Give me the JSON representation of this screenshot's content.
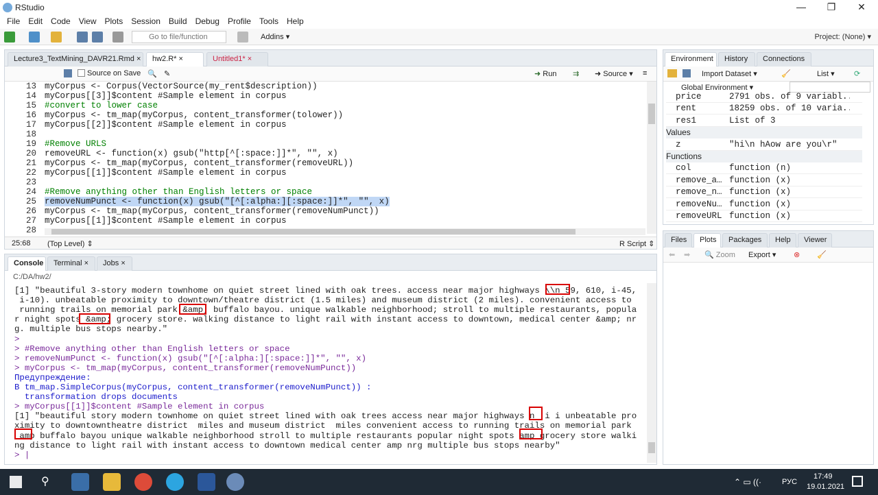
{
  "window": {
    "title": "RStudio",
    "min": "—",
    "max": "❐",
    "close": "✕"
  },
  "menu": [
    "File",
    "Edit",
    "Code",
    "View",
    "Plots",
    "Session",
    "Build",
    "Debug",
    "Profile",
    "Tools",
    "Help"
  ],
  "toolbar": {
    "goto_placeholder": "Go to file/function",
    "addins": "Addins ▾",
    "project": "Project: (None) ▾"
  },
  "editor": {
    "tabs": [
      "Lecture3_TextMining_DAVR21.Rmd",
      "hw2.R*",
      "Untitled1*"
    ],
    "source_on_save": "Source on Save",
    "run": "Run",
    "source": "Source ▾",
    "lines": [
      {
        "n": "13",
        "t": "myCorpus <- Corpus(VectorSource(my_rent$description))"
      },
      {
        "n": "14",
        "t": "myCorpus[[3]]$content #Sample element in corpus"
      },
      {
        "n": "15",
        "t": "#convert to lower case"
      },
      {
        "n": "16",
        "t": "myCorpus <- tm_map(myCorpus, content_transformer(tolower))"
      },
      {
        "n": "17",
        "t": "myCorpus[[2]]$content #Sample element in corpus"
      },
      {
        "n": "18",
        "t": ""
      },
      {
        "n": "19",
        "t": "#Remove URLS"
      },
      {
        "n": "20",
        "t": "removeURL <- function(x) gsub(\"http[^[:space:]]*\", \"\", x)"
      },
      {
        "n": "21",
        "t": "myCorpus <- tm_map(myCorpus, content_transformer(removeURL))"
      },
      {
        "n": "22",
        "t": "myCorpus[[1]]$content #Sample element in corpus"
      },
      {
        "n": "23",
        "t": ""
      },
      {
        "n": "24",
        "t": "#Remove anything other than English letters or space"
      },
      {
        "n": "25",
        "t": "removeNumPunct <- function(x) gsub(\"[^[:alpha:][:space:]]*\", \"\", x)"
      },
      {
        "n": "26",
        "t": "myCorpus <- tm_map(myCorpus, content_transformer(removeNumPunct))"
      },
      {
        "n": "27",
        "t": "myCorpus[[1]]$content #Sample element in corpus"
      },
      {
        "n": "28",
        "t": ""
      }
    ],
    "status_pos": "25:68",
    "status_scope": "(Top Level) ⇕",
    "status_type": "R Script ⇕"
  },
  "console": {
    "tabs": [
      "Console",
      "Terminal",
      "Jobs"
    ],
    "path": "C:/DA/hw2/",
    "lines": [
      {
        "c": "out",
        "t": "[1] \"beautiful 3-story modern townhome on quiet street lined with oak trees. access near major highways \\\\n 59, 610, i-45,"
      },
      {
        "c": "out",
        "t": " i-10). unbeatable proximity to downtown/theatre district (1.5 miles) and museum district (2 miles). convenient access to"
      },
      {
        "c": "out",
        "t": " running trails on memorial park &amp; buffalo bayou. unique walkable neighborhood; stroll to multiple restaurants, popula"
      },
      {
        "c": "out",
        "t": "r night spots &amp; grocery store. walking distance to light rail with instant access to downtown, medical center &amp; nr"
      },
      {
        "c": "out",
        "t": "g. multiple bus stops nearby.\""
      },
      {
        "c": "echo",
        "t": ">"
      },
      {
        "c": "echo",
        "t": "> #Remove anything other than English letters or space"
      },
      {
        "c": "echo",
        "t": "> removeNumPunct <- function(x) gsub(\"[^[:alpha:][:space:]]*\", \"\", x)"
      },
      {
        "c": "echo",
        "t": "> myCorpus <- tm_map(myCorpus, content_transformer(removeNumPunct))"
      },
      {
        "c": "blue",
        "t": "Предупреждение:"
      },
      {
        "c": "blue",
        "t": "В tm_map.SimpleCorpus(myCorpus, content_transformer(removeNumPunct)) :"
      },
      {
        "c": "blue",
        "t": "  transformation drops documents"
      },
      {
        "c": "echo",
        "t": "> myCorpus[[1]]$content #Sample element in corpus"
      },
      {
        "c": "out",
        "t": "[1] \"beautiful story modern townhome on quiet street lined with oak trees access near major highways n  i i unbeatable pro"
      },
      {
        "c": "out",
        "t": "ximity to downtowntheatre district  miles and museum district  miles convenient access to running trails on memorial park"
      },
      {
        "c": "out",
        "t": " amp buffalo bayou unique walkable neighborhood stroll to multiple restaurants popular night spots amp grocery store walki"
      },
      {
        "c": "out",
        "t": "ng distance to light rail with instant access to downtown medical center amp nrg multiple bus stops nearby\""
      },
      {
        "c": "echo",
        "t": "> |"
      }
    ]
  },
  "environment": {
    "tabs": [
      "Environment",
      "History",
      "Connections"
    ],
    "import": "Import Dataset ▾",
    "list": "List ▾",
    "global": "Global Environment ▾",
    "rows": [
      {
        "k": "r",
        "name": "price",
        "value": "2791 obs. of 9 variabl..."
      },
      {
        "k": "r",
        "name": "rent",
        "value": "18259 obs. of 10 varia..."
      },
      {
        "k": "r",
        "name": "res1",
        "value": "List of 3"
      },
      {
        "k": "h",
        "name": "Values"
      },
      {
        "k": "r",
        "name": "z",
        "value": "\"hi\\n hAow are you\\r\""
      },
      {
        "k": "h",
        "name": "Functions"
      },
      {
        "k": "r",
        "name": "col",
        "value": "function (n)"
      },
      {
        "k": "r",
        "name": "remove_a…",
        "value": "function (x)"
      },
      {
        "k": "r",
        "name": "remove_n…",
        "value": "function (x)"
      },
      {
        "k": "r",
        "name": "removeNu…",
        "value": "function (x)"
      },
      {
        "k": "r",
        "name": "removeURL",
        "value": "function (x)"
      }
    ]
  },
  "files": {
    "tabs": [
      "Files",
      "Plots",
      "Packages",
      "Help",
      "Viewer"
    ],
    "zoom": "Zoom",
    "export": "Export ▾"
  },
  "taskbar": {
    "lang": "РУС",
    "time": "17:49",
    "date": "19.01.2021"
  }
}
